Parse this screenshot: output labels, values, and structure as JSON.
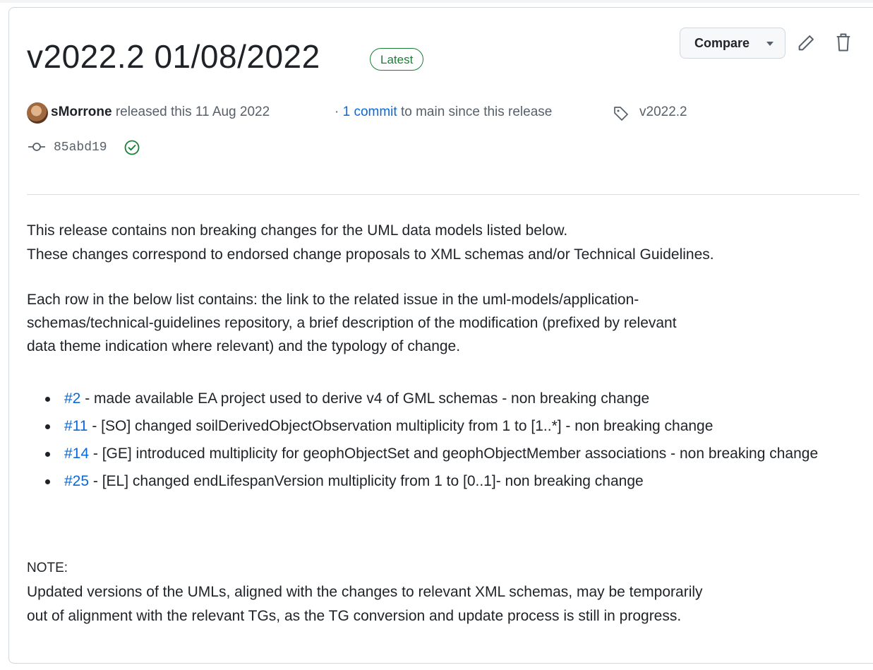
{
  "release": {
    "title": "v2022.2 01/08/2022",
    "badge": "Latest",
    "compare_label": "Compare",
    "author": "sMorrone",
    "released_text": "released this 11 Aug 2022",
    "commits_prefix": "·",
    "commits_link": "1 commit",
    "commits_suffix": "to main since this release",
    "tag": "v2022.2",
    "commit_sha": "85abd19",
    "status_color": "#1a7f37"
  },
  "icons": {
    "edit": "pencil-icon",
    "delete": "trash-icon",
    "tag": "tag-icon",
    "commit": "git-commit-icon",
    "verified": "check-circle-icon"
  },
  "body": {
    "intro_line1": "This release contains non breaking changes for the UML data models listed below.",
    "intro_line2": "These changes correspond to endorsed change proposals to XML schemas and/or Technical Guidelines.",
    "desc_line1": "Each row in the below list contains: the link to the related issue in the uml-models/application-",
    "desc_line2": "schemas/technical-guidelines repository, a brief description of the modification (prefixed by relevant",
    "desc_line3": "data theme indication where relevant) and the typology of change.",
    "items": [
      {
        "issue": "#2",
        "text": " - made available EA project used to derive v4 of GML schemas - non breaking change"
      },
      {
        "issue": "#11",
        "text": " - [SO] changed soilDerivedObjectObservation multiplicity from 1 to [1..*] - non breaking change"
      },
      {
        "issue": "#14",
        "text": " - [GE] introduced multiplicity for geophObjectSet and geophObjectMember associations - non breaking change"
      },
      {
        "issue": "#25",
        "text": " - [EL] changed endLifespanVersion multiplicity from 1 to [0..1]- non breaking change"
      }
    ],
    "note_label": "NOTE:",
    "note_line1": "Updated versions of the UMLs, aligned with the changes to relevant XML schemas, may be temporarily",
    "note_line2": "out of alignment with the relevant TGs, as the TG conversion and update process is still in progress."
  }
}
